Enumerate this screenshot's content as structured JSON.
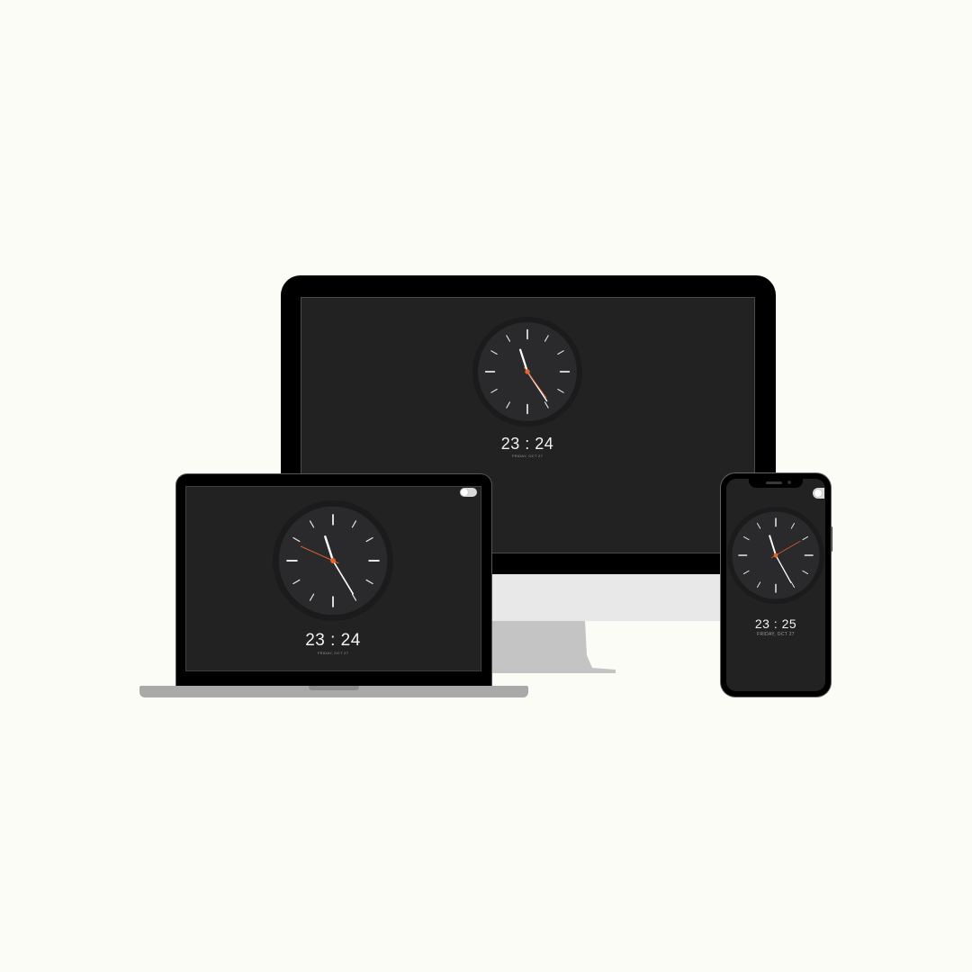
{
  "colors": {
    "background": "#fcfcf7",
    "screen": "#222223",
    "clock_face": "#2a2a2c",
    "clock_rim": "#1b1b1c",
    "second_hand": "#e8652a",
    "hands": "#ffffff"
  },
  "devices": {
    "desktop": {
      "time": "23 : 24",
      "date": "FRIDAY, OCT 27",
      "clock": {
        "hour": 23,
        "minute": 24,
        "second": 24
      }
    },
    "laptop": {
      "time": "23 : 24",
      "date": "FRIDAY, OCT 27",
      "clock": {
        "hour": 23,
        "minute": 24,
        "second": 49
      },
      "toggle_icon": "theme-toggle-icon"
    },
    "phone": {
      "time": "23 : 25",
      "date": "FRIDAY, OCT 27",
      "clock": {
        "hour": 23,
        "minute": 25,
        "second": 10
      },
      "toggle_icon": "theme-toggle-icon"
    }
  }
}
